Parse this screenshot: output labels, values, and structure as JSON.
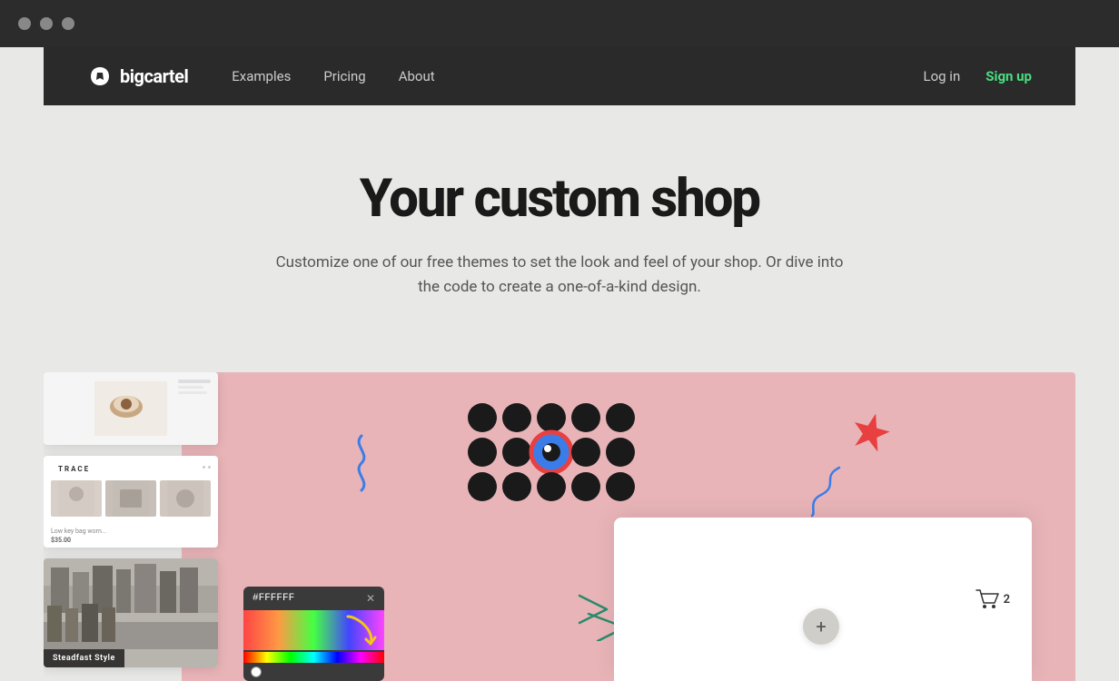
{
  "browser": {
    "dots": [
      "dot1",
      "dot2",
      "dot3"
    ]
  },
  "navbar": {
    "logo_text": "bigcartel",
    "nav_items": [
      {
        "label": "Examples",
        "id": "examples"
      },
      {
        "label": "Pricing",
        "id": "pricing"
      },
      {
        "label": "About",
        "id": "about"
      }
    ],
    "login_label": "Log in",
    "signup_label": "Sign up"
  },
  "hero": {
    "title": "Your custom shop",
    "subtitle": "Customize one of our free themes to set the look and feel of your shop. Or dive into the code to create a one-of-a-kind design."
  },
  "preview": {
    "store_name": "TRACE",
    "steadfast_label": "Steadfast Style",
    "color_hex": "#FFFFFF"
  },
  "cart": {
    "add_icon": "+",
    "cart_count": "2"
  }
}
